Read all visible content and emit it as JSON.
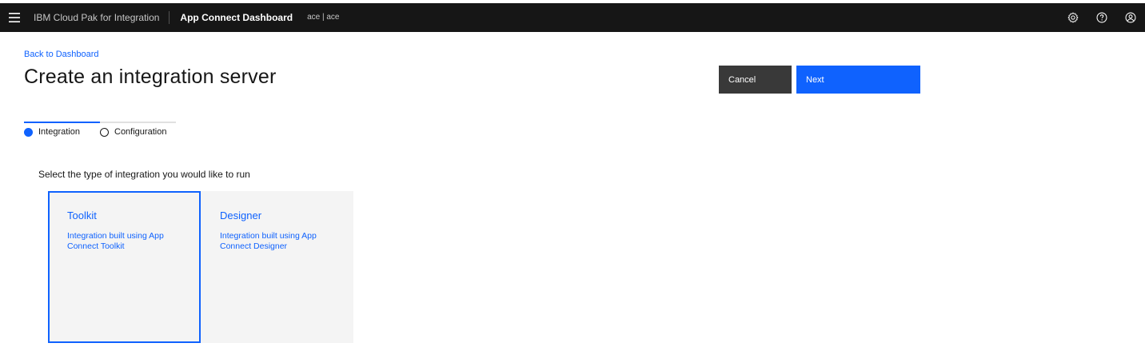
{
  "header": {
    "brand": "IBM Cloud Pak for Integration",
    "app_name": "App Connect Dashboard",
    "namespace": "ace | ace",
    "menu_icon": "hamburger-menu-icon",
    "icons": [
      "settings-icon",
      "help-icon",
      "user-avatar-icon"
    ]
  },
  "page": {
    "back_link": "Back to Dashboard",
    "title": "Create an integration server",
    "cancel_label": "Cancel",
    "next_label": "Next"
  },
  "progress": {
    "steps": [
      {
        "label": "Integration",
        "state": "current"
      },
      {
        "label": "Configuration",
        "state": "incomplete"
      }
    ]
  },
  "content": {
    "prompt": "Select the type of integration you would like to run",
    "tiles": [
      {
        "title": "Toolkit",
        "description": "Integration built using App Connect Toolkit",
        "selected": true
      },
      {
        "title": "Designer",
        "description": "Integration built using App Connect Designer",
        "selected": false
      }
    ]
  },
  "colors": {
    "accent": "#0f62fe",
    "header_bg": "#161616",
    "secondary_button": "#393939",
    "tile_bg": "#f4f4f4"
  }
}
